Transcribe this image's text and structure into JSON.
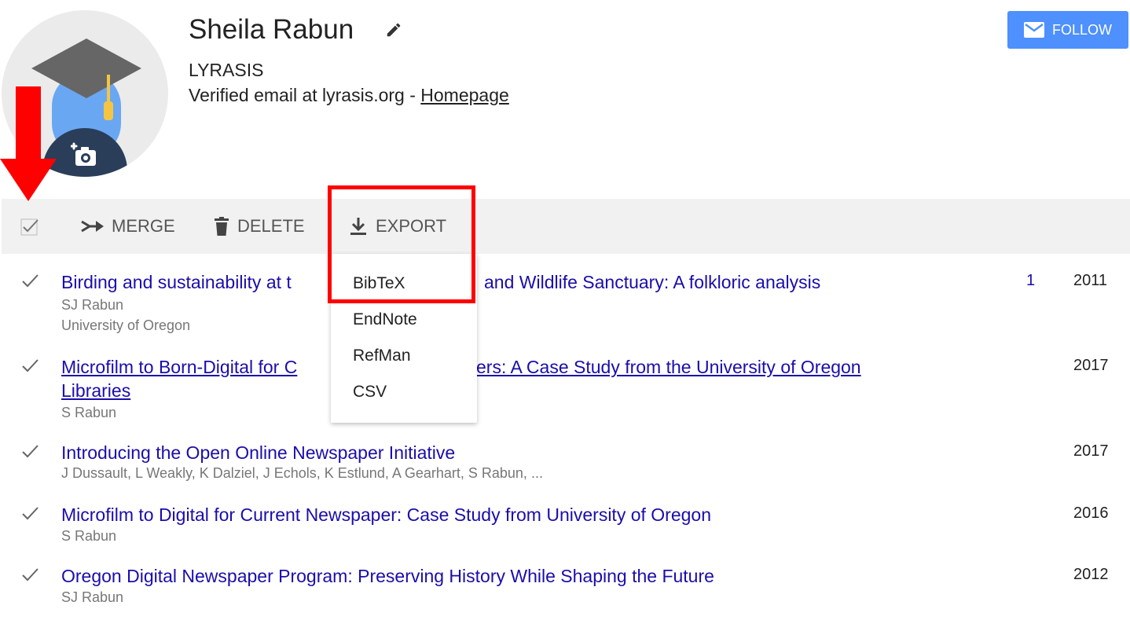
{
  "profile": {
    "name": "Sheila Rabun",
    "affiliation": "LYRASIS",
    "email_prefix": "Verified email at lyrasis.org - ",
    "homepage_label": "Homepage"
  },
  "follow": {
    "label": "FOLLOW"
  },
  "toolbar": {
    "merge_label": "MERGE",
    "delete_label": "DELETE",
    "export_label": "EXPORT"
  },
  "export_menu": [
    "BibTeX",
    "EndNote",
    "RefMan",
    "CSV"
  ],
  "articles": [
    {
      "title_left": "Birding and sustainability at t",
      "title_right": "and Wildlife Sanctuary: A folkloric analysis",
      "authors": "SJ Rabun",
      "venue": "University of Oregon",
      "cited": "1",
      "year": "2011"
    },
    {
      "title_line1_left": "Microfilm to Born-Digital for C",
      "title_line1_right": "ers: A Case Study from the University of Oregon",
      "title_line2": "Libraries",
      "authors": "S Rabun",
      "year": "2017"
    },
    {
      "title": "Introducing the Open Online Newspaper Initiative",
      "authors": "J Dussault, L Weakly, K Dalziel, J Echols, K Estlund, A Gearhart, S Rabun, ...",
      "year": "2017"
    },
    {
      "title": "Microfilm to Digital for Current Newspaper: Case Study from University of Oregon",
      "authors": "S Rabun",
      "year": "2016"
    },
    {
      "title": "Oregon Digital Newspaper Program: Preserving History While Shaping the Future",
      "authors": "SJ Rabun",
      "year": "2012"
    }
  ],
  "colors": {
    "link": "#1a0dab",
    "follow_bg": "#4d90fe",
    "toolbar_bg": "#f1f1f1",
    "annotation_red": "#ff0000"
  }
}
